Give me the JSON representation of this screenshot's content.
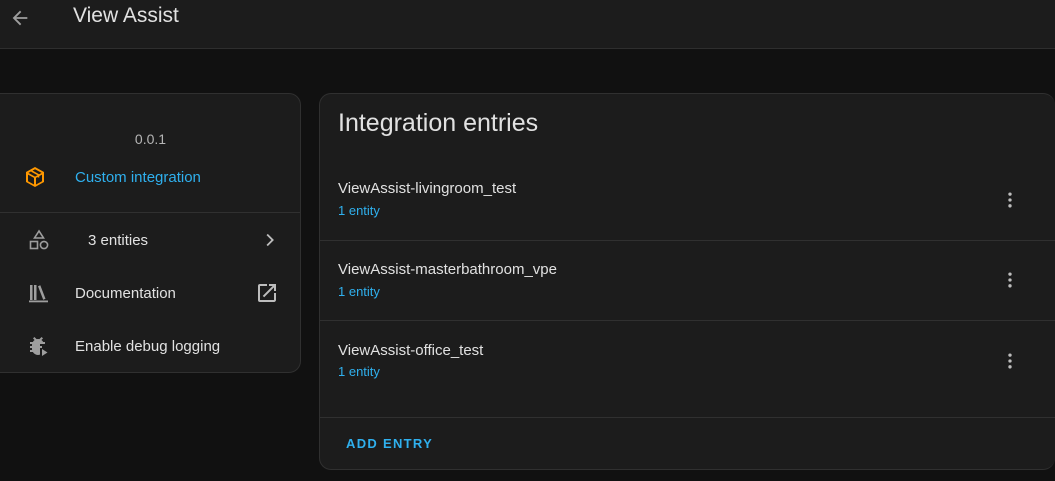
{
  "header": {
    "title": "View Assist",
    "back_icon": "arrow-left-icon"
  },
  "info_card": {
    "version": "0.0.1",
    "custom_integration": {
      "label": "Custom integration",
      "icon": "package-icon",
      "color": "#ff9800"
    },
    "entities": {
      "label": "3 entities",
      "icon": "shapes-icon"
    },
    "documentation": {
      "label": "Documentation",
      "icon": "bookshelf-icon"
    },
    "debug_logging": {
      "label": "Enable debug logging",
      "icon": "bug-play-icon"
    }
  },
  "entries_card": {
    "title": "Integration entries",
    "entries": [
      {
        "name": "ViewAssist-livingroom_test",
        "sub": "1 entity"
      },
      {
        "name": "ViewAssist-masterbathroom_vpe",
        "sub": "1 entity"
      },
      {
        "name": "ViewAssist-office_test",
        "sub": "1 entity"
      }
    ],
    "add_entry_label": "ADD ENTRY"
  },
  "colors": {
    "accent": "#2fb0ee",
    "background": "#111111",
    "card": "#1c1c1c",
    "integration_icon": "#ff9800"
  }
}
